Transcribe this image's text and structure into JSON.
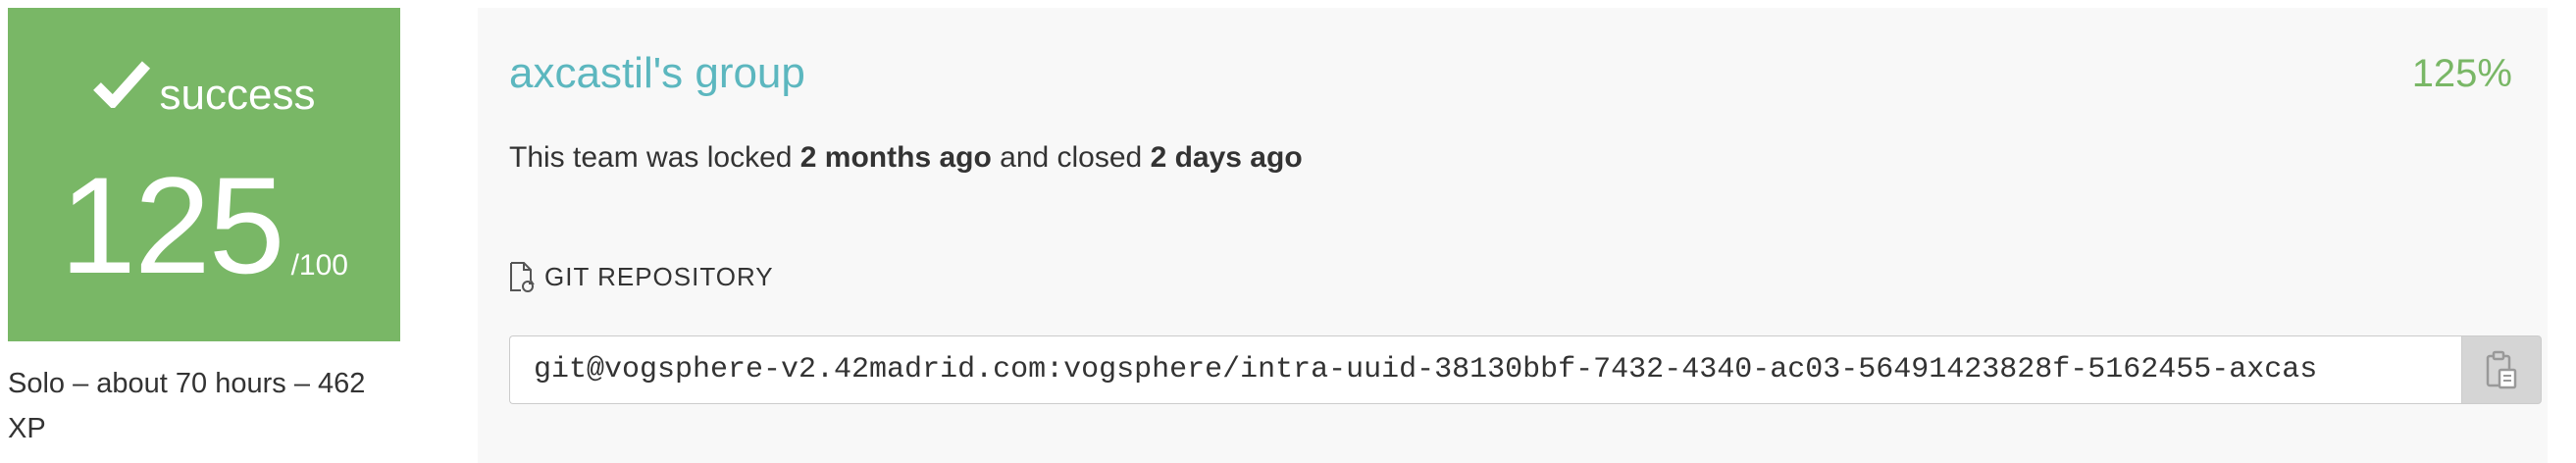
{
  "score_card": {
    "status_icon": "check-icon",
    "status_label": "success",
    "grade": "125",
    "grade_max": "/100",
    "background_color": "#79b766"
  },
  "team_meta": {
    "text": "Solo – about 70 hours – 462 XP"
  },
  "team": {
    "name": "axcastil's group",
    "percent": "125%",
    "name_color": "#5cb7bf",
    "percent_color": "#79b766"
  },
  "lock_info": {
    "prefix": "This team was locked ",
    "locked_ago": "2 months ago",
    "middle": " and closed ",
    "closed_ago": "2 days ago"
  },
  "repository": {
    "header_icon": "git-icon",
    "header_label": "GIT REPOSITORY",
    "url": "git@vogsphere-v2.42madrid.com:vogsphere/intra-uuid-38130bbf-7432-4340-ac03-56491423828f-5162455-axcas",
    "copy_icon": "clipboard-icon"
  }
}
